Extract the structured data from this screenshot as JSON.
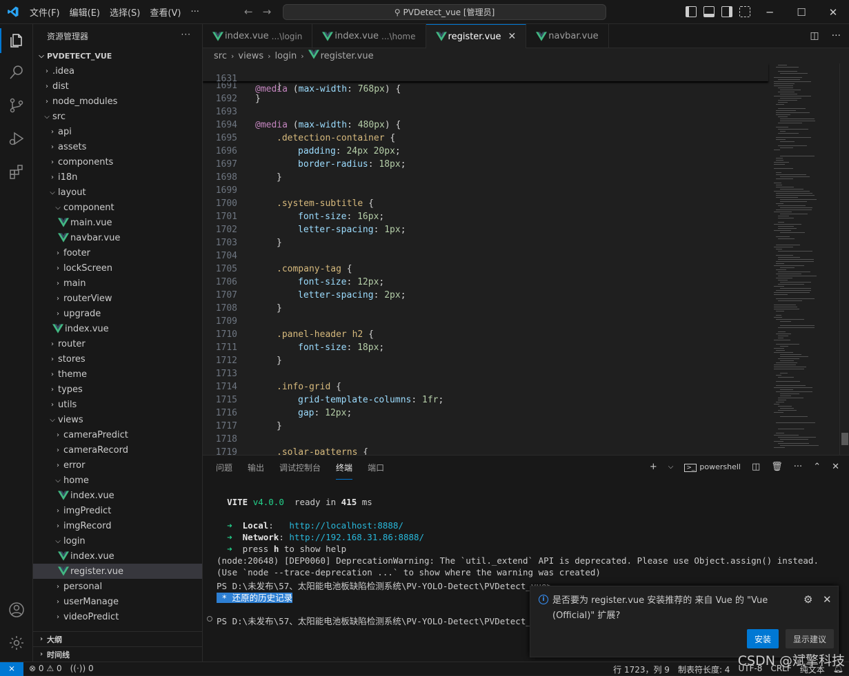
{
  "menu": [
    "文件(F)",
    "编辑(E)",
    "选择(S)",
    "查看(V)",
    "···"
  ],
  "command_center": "PVDetect_vue [管理员]",
  "colors": {
    "accent": "#0078d4",
    "vue_green": "#42b883",
    "editor_bg": "#1f1f1f"
  },
  "explorer": {
    "title": "资源管理器",
    "more": "···",
    "root": "PVDETECT_VUE",
    "items": [
      {
        "label": ".idea",
        "type": "folder",
        "depth": 1,
        "open": false
      },
      {
        "label": "dist",
        "type": "folder",
        "depth": 1,
        "open": false
      },
      {
        "label": "node_modules",
        "type": "folder",
        "depth": 1,
        "open": false
      },
      {
        "label": "src",
        "type": "folder",
        "depth": 1,
        "open": true
      },
      {
        "label": "api",
        "type": "folder",
        "depth": 2,
        "open": false
      },
      {
        "label": "assets",
        "type": "folder",
        "depth": 2,
        "open": false
      },
      {
        "label": "components",
        "type": "folder",
        "depth": 2,
        "open": false
      },
      {
        "label": "i18n",
        "type": "folder",
        "depth": 2,
        "open": false
      },
      {
        "label": "layout",
        "type": "folder",
        "depth": 2,
        "open": true
      },
      {
        "label": "component",
        "type": "folder",
        "depth": 3,
        "open": true
      },
      {
        "label": "main.vue",
        "type": "vue",
        "depth": 4
      },
      {
        "label": "navbar.vue",
        "type": "vue",
        "depth": 4
      },
      {
        "label": "footer",
        "type": "folder",
        "depth": 3,
        "open": false
      },
      {
        "label": "lockScreen",
        "type": "folder",
        "depth": 3,
        "open": false
      },
      {
        "label": "main",
        "type": "folder",
        "depth": 3,
        "open": false
      },
      {
        "label": "routerView",
        "type": "folder",
        "depth": 3,
        "open": false
      },
      {
        "label": "upgrade",
        "type": "folder",
        "depth": 3,
        "open": false
      },
      {
        "label": "index.vue",
        "type": "vue",
        "depth": 3
      },
      {
        "label": "router",
        "type": "folder",
        "depth": 2,
        "open": false
      },
      {
        "label": "stores",
        "type": "folder",
        "depth": 2,
        "open": false
      },
      {
        "label": "theme",
        "type": "folder",
        "depth": 2,
        "open": false
      },
      {
        "label": "types",
        "type": "folder",
        "depth": 2,
        "open": false
      },
      {
        "label": "utils",
        "type": "folder",
        "depth": 2,
        "open": false
      },
      {
        "label": "views",
        "type": "folder",
        "depth": 2,
        "open": true
      },
      {
        "label": "cameraPredict",
        "type": "folder",
        "depth": 3,
        "open": false
      },
      {
        "label": "cameraRecord",
        "type": "folder",
        "depth": 3,
        "open": false
      },
      {
        "label": "error",
        "type": "folder",
        "depth": 3,
        "open": false
      },
      {
        "label": "home",
        "type": "folder",
        "depth": 3,
        "open": true
      },
      {
        "label": "index.vue",
        "type": "vue",
        "depth": 4
      },
      {
        "label": "imgPredict",
        "type": "folder",
        "depth": 3,
        "open": false
      },
      {
        "label": "imgRecord",
        "type": "folder",
        "depth": 3,
        "open": false
      },
      {
        "label": "login",
        "type": "folder",
        "depth": 3,
        "open": true
      },
      {
        "label": "index.vue",
        "type": "vue",
        "depth": 4
      },
      {
        "label": "register.vue",
        "type": "vue",
        "depth": 4,
        "selected": true
      },
      {
        "label": "personal",
        "type": "folder",
        "depth": 3,
        "open": false
      },
      {
        "label": "userManage",
        "type": "folder",
        "depth": 3,
        "open": false
      },
      {
        "label": "videoPredict",
        "type": "folder",
        "depth": 3,
        "open": false
      }
    ],
    "outline": "大纲",
    "timeline": "时间线"
  },
  "tabs": [
    {
      "label": "index.vue",
      "desc": "...\\login",
      "active": false
    },
    {
      "label": "index.vue",
      "desc": "...\\home",
      "active": false
    },
    {
      "label": "register.vue",
      "desc": "",
      "active": true
    },
    {
      "label": "navbar.vue",
      "desc": "",
      "active": false
    }
  ],
  "tab_close": "✕",
  "breadcrumb": [
    "src",
    "views",
    "login",
    "register.vue"
  ],
  "sticky": {
    "num": "1631",
    "text": "@media (max-width: 768px) {"
  },
  "code": [
    {
      "num": "1691",
      "indent": 1,
      "text": "}"
    },
    {
      "num": "1692",
      "indent": 0,
      "text": "}"
    },
    {
      "num": "1693",
      "indent": 0,
      "text": ""
    },
    {
      "num": "1694",
      "indent": 0,
      "text": "@media (max-width: 480px) {"
    },
    {
      "num": "1695",
      "indent": 1,
      "text": ".detection-container {"
    },
    {
      "num": "1696",
      "indent": 2,
      "text": "padding: 24px 20px;"
    },
    {
      "num": "1697",
      "indent": 2,
      "text": "border-radius: 18px;"
    },
    {
      "num": "1698",
      "indent": 1,
      "text": "}"
    },
    {
      "num": "1699",
      "indent": 0,
      "text": ""
    },
    {
      "num": "1700",
      "indent": 1,
      "text": ".system-subtitle {"
    },
    {
      "num": "1701",
      "indent": 2,
      "text": "font-size: 16px;"
    },
    {
      "num": "1702",
      "indent": 2,
      "text": "letter-spacing: 1px;"
    },
    {
      "num": "1703",
      "indent": 1,
      "text": "}"
    },
    {
      "num": "1704",
      "indent": 0,
      "text": ""
    },
    {
      "num": "1705",
      "indent": 1,
      "text": ".company-tag {"
    },
    {
      "num": "1706",
      "indent": 2,
      "text": "font-size: 12px;"
    },
    {
      "num": "1707",
      "indent": 2,
      "text": "letter-spacing: 2px;"
    },
    {
      "num": "1708",
      "indent": 1,
      "text": "}"
    },
    {
      "num": "1709",
      "indent": 0,
      "text": ""
    },
    {
      "num": "1710",
      "indent": 1,
      "text": ".panel-header h2 {"
    },
    {
      "num": "1711",
      "indent": 2,
      "text": "font-size: 18px;"
    },
    {
      "num": "1712",
      "indent": 1,
      "text": "}"
    },
    {
      "num": "1713",
      "indent": 0,
      "text": ""
    },
    {
      "num": "1714",
      "indent": 1,
      "text": ".info-grid {"
    },
    {
      "num": "1715",
      "indent": 2,
      "text": "grid-template-columns: 1fr;"
    },
    {
      "num": "1716",
      "indent": 2,
      "text": "gap: 12px;"
    },
    {
      "num": "1717",
      "indent": 1,
      "text": "}"
    },
    {
      "num": "1718",
      "indent": 0,
      "text": ""
    },
    {
      "num": "1719",
      "indent": 1,
      "text": ".solar-patterns {"
    }
  ],
  "panel": {
    "tabs": [
      "问题",
      "输出",
      "调试控制台",
      "终端",
      "端口"
    ],
    "active_tab": 3,
    "shell": "powershell",
    "add": "+",
    "more": "···"
  },
  "terminal": {
    "vite": "VITE",
    "version": "v4.0.0",
    "ready_a": "ready in",
    "ready_ms": "415",
    "ready_b": "ms",
    "arrow": "➜",
    "local_label": "Local",
    "local_colon": ":",
    "local_url": "http://localhost:8888/",
    "network_label": "Network",
    "network_colon": ":",
    "network_url": "http://192.168.31.86:8888/",
    "help_a": "press",
    "help_key": "h",
    "help_b": "to show help",
    "warn1": "(node:20648) [DEP0060] DeprecationWarning: The `util._extend` API is deprecated. Please use Object.assign() instead.",
    "warn2": "(Use `node --trace-deprecation ...` to show where the warning was created)",
    "prompt1": "PS D:\\未发布\\57、太阳能电池板缺陷检测系统\\PV-YOLO-Detect\\PVDetect_vue>",
    "history_star": " * ",
    "history": "还原的历史记录",
    "prompt2": "PS D:\\未发布\\57、太阳能电池板缺陷检测系统\\PV-YOLO-Detect\\PVDetect_vue"
  },
  "notification": {
    "message": "是否要为 register.vue 安装推荐的 来自 Vue 的 \"Vue (Official)\" 扩展?",
    "install": "安装",
    "show": "显示建议"
  },
  "status": {
    "errors": "0",
    "warnings": "0",
    "ports": "0",
    "position": "行 1723，列 9",
    "tab_size": "制表符长度: 4",
    "encoding": "UTF-8",
    "eol": "CRLF",
    "lang": "纯文本"
  },
  "watermark": "CSDN @斌擎科技"
}
